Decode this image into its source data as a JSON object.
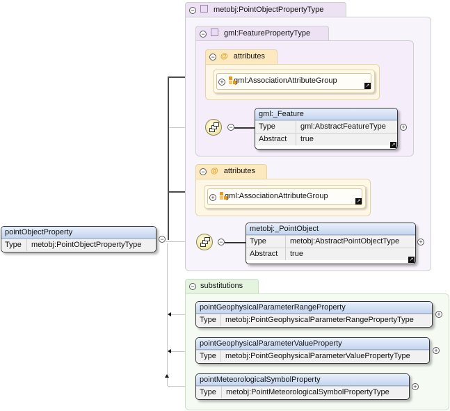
{
  "root": {
    "name": "pointObjectProperty",
    "type_key": "Type",
    "type_value": "metobj:PointObjectPropertyType"
  },
  "outer_type": {
    "label": "metobj:PointObjectPropertyType"
  },
  "inner_type": {
    "label": "gml:FeaturePropertyType"
  },
  "attributes_label": "attributes",
  "inner_attributes": {
    "group": "gml:AssociationAttributeGroup"
  },
  "outer_attributes": {
    "group": "gml:AssociationAttributeGroup"
  },
  "feature_element": {
    "name": "gml:_Feature",
    "rows": [
      {
        "key": "Type",
        "value": "gml:AbstractFeatureType"
      },
      {
        "key": "Abstract",
        "value": "true"
      }
    ]
  },
  "point_element": {
    "name": "metobj:_PointObject",
    "rows": [
      {
        "key": "Type",
        "value": "metobj:AbstractPointObjectType"
      },
      {
        "key": "Abstract",
        "value": "true"
      }
    ]
  },
  "substitutions": {
    "label": "substitutions",
    "items": [
      {
        "name": "pointGeophysicalParameterRangeProperty",
        "type_key": "Type",
        "type_value": "metobj:PointGeophysicalParameterRangePropertyType"
      },
      {
        "name": "pointGeophysicalParameterValueProperty",
        "type_key": "Type",
        "type_value": "metobj:PointGeophysicalParameterValuePropertyType"
      },
      {
        "name": "pointMeteorologicalSymbolProperty",
        "type_key": "Type",
        "type_value": "metobj:PointMeteorologicalSymbolPropertyType"
      }
    ]
  }
}
